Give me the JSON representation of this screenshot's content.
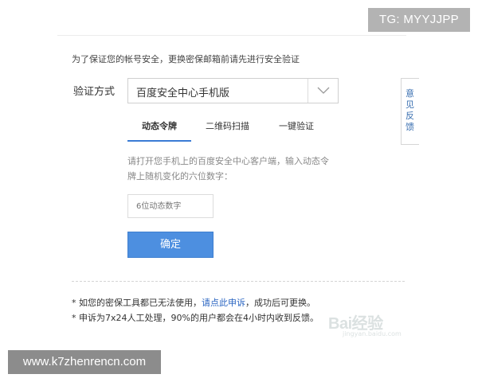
{
  "watermarks": {
    "top_right": "TG: MYYJJPP",
    "bottom_left": "www.k7zhenrencn.com",
    "baidu": "Bai",
    "baidu_jingyan": "经验",
    "baidu_sub": "jingyan.baidu.com"
  },
  "notice": "为了保证您的帐号安全，更换密保邮箱前请先进行安全验证",
  "method": {
    "label": "验证方式",
    "selected": "百度安全中心手机版"
  },
  "feedback_label": "意见反馈",
  "tabs": [
    {
      "label": "动态令牌",
      "active": true
    },
    {
      "label": "二维码扫描",
      "active": false
    },
    {
      "label": "一键验证",
      "active": false
    }
  ],
  "hint": "请打开您手机上的百度安全中心客户端，输入动态令牌上随机变化的六位数字：",
  "code_input": {
    "placeholder": "6位动态数字",
    "value": ""
  },
  "confirm_label": "确定",
  "notes": {
    "line1_prefix": "* 如您的密保工具都已无法使用，",
    "line1_link": "请点此申诉",
    "line1_suffix": "，成功后可更换。",
    "line2": "* 申诉为7x24人工处理，90%的用户都会在4小时内收到反馈。"
  },
  "colors": {
    "accent": "#4d8fe0",
    "link": "#2b66c2",
    "tab_underline": "#3a7bd5"
  }
}
